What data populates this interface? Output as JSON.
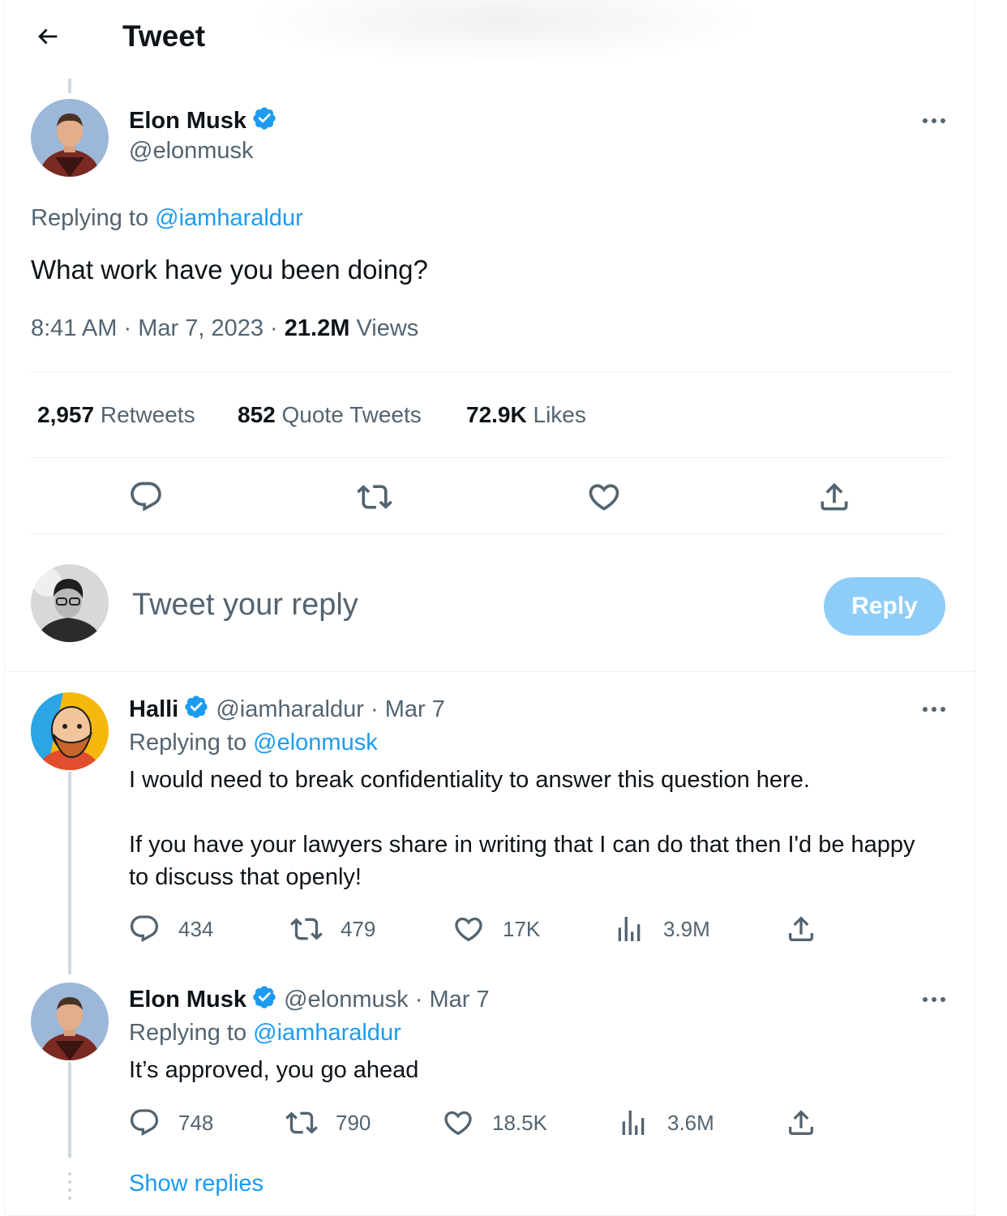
{
  "header": {
    "title": "Tweet"
  },
  "main_tweet": {
    "name": "Elon Musk",
    "handle": "@elonmusk",
    "replying_prefix": "Replying to",
    "replying_to": "@iamharaldur",
    "text": "What work have you been doing?",
    "time": "8:41 AM",
    "sep1": "·",
    "date": "Mar 7, 2023",
    "sep2": "·",
    "views_count": "21.2M",
    "views_label": "Views",
    "stats": [
      {
        "count": "2,957",
        "label": "Retweets"
      },
      {
        "count": "852",
        "label": "Quote Tweets"
      },
      {
        "count": "72.9K",
        "label": "Likes"
      }
    ]
  },
  "compose": {
    "placeholder": "Tweet your reply",
    "button": "Reply"
  },
  "replies": [
    {
      "name": "Halli",
      "handle": "@iamharaldur",
      "sep": "·",
      "date": "Mar 7",
      "replying_prefix": "Replying to",
      "replying_to": "@elonmusk",
      "text_p1": "I would need to break confidentiality to answer this question here.",
      "text_p2": "If you have your lawyers share in writing that I can do that then I'd be happy to discuss that openly!",
      "actions": {
        "replies": "434",
        "retweets": "479",
        "likes": "17K",
        "views": "3.9M"
      }
    },
    {
      "name": "Elon Musk",
      "handle": "@elonmusk",
      "sep": "·",
      "date": "Mar 7",
      "replying_prefix": "Replying to",
      "replying_to": "@iamharaldur",
      "text_p1": "It’s approved, you go ahead",
      "actions": {
        "replies": "748",
        "retweets": "790",
        "likes": "18.5K",
        "views": "3.6M"
      }
    }
  ],
  "show_replies": "Show replies",
  "colors": {
    "accent": "#1d9bf0",
    "text": "#0f1419",
    "muted": "#536471",
    "reply_button_disabled": "#8ecdf8",
    "border": "#eff3f4"
  },
  "icons": [
    "back-arrow-icon",
    "verified-badge-icon",
    "more-icon",
    "reply-icon",
    "retweet-icon",
    "like-icon",
    "share-icon",
    "views-icon"
  ]
}
